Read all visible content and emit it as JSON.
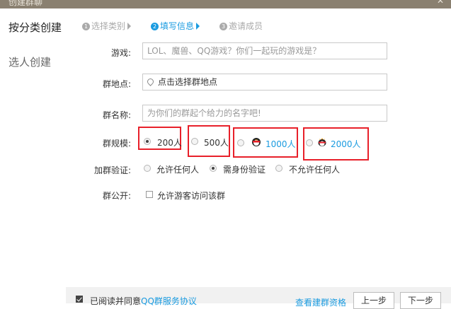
{
  "window": {
    "title": "创建群聊"
  },
  "sidebar": {
    "items": [
      {
        "label": "按分类创建"
      },
      {
        "label": "选人创建"
      }
    ]
  },
  "steps": [
    {
      "num": "1",
      "label": "选择类别"
    },
    {
      "num": "2",
      "label": "填写信息"
    },
    {
      "num": "3",
      "label": "邀请成员"
    }
  ],
  "form": {
    "game": {
      "label": "游戏:",
      "placeholder": "LOL、魔兽、QQ游戏？你们一起玩的游戏是？"
    },
    "location": {
      "label": "群地点:",
      "value": "点击选择群地点"
    },
    "name": {
      "label": "群名称:",
      "placeholder": "为你们的群起个给力的名字吧!"
    },
    "size": {
      "label": "群规模:",
      "options": [
        "200人",
        "500人",
        "1000人",
        "2000人"
      ],
      "selected": "200人"
    },
    "verify": {
      "label": "加群验证:",
      "options": [
        "允许任何人",
        "需身份验证",
        "不允许任何人"
      ],
      "selected": "需身份验证"
    },
    "public": {
      "label": "群公开:",
      "checkbox_label": "允许游客访问该群",
      "checked": false
    }
  },
  "footer": {
    "agree_text": "已阅读并同意",
    "agree_link": "QQ群服务协议",
    "agree_checked": true,
    "right_link": "查看建群资格",
    "prev_button": "上一步",
    "next_button": "下一步"
  },
  "colors": {
    "accent": "#1a9be0",
    "highlight_box": "#e8202a"
  }
}
